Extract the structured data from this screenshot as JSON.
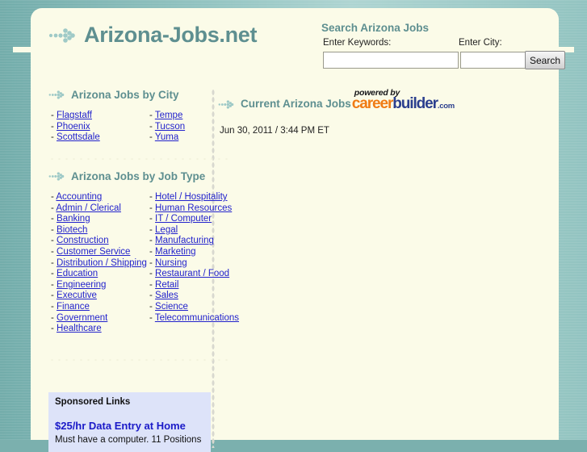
{
  "site": {
    "logo_text": "Arizona-Jobs.net",
    "logo_icon": "dotted-arrow-icon",
    "brand_color": "#5e8f90"
  },
  "search": {
    "title": "Search Arizona Jobs",
    "keywords_label": "Enter Keywords:",
    "city_label": "Enter City:",
    "keywords_value": "",
    "city_value": "",
    "keywords_placeholder": "",
    "city_placeholder": "",
    "button_label": "Search"
  },
  "cities_section": {
    "title": "Arizona Jobs by City",
    "icon": "dotted-arrow-icon",
    "column1": [
      "Flagstaff",
      "Phoenix",
      "Scottsdale"
    ],
    "column2": [
      "Tempe",
      "Tucson",
      "Yuma"
    ]
  },
  "jobtypes_section": {
    "title": "Arizona Jobs by Job Type",
    "icon": "dotted-arrow-icon",
    "column1": [
      "Accounting",
      "Admin / Clerical",
      "Banking",
      "Biotech",
      "Construction",
      "Customer Service",
      "Distribution / Shipping",
      "Education",
      "Engineering",
      "Executive",
      "Finance",
      "Government",
      "Healthcare"
    ],
    "column2": [
      "Hotel / Hospitality",
      "Human Resources",
      "IT / Computer",
      "Legal",
      "Manufacturing",
      "Marketing",
      "Nursing",
      "Restaurant / Food",
      "Retail",
      "Sales",
      "Science",
      "Telecommunications"
    ]
  },
  "current_jobs": {
    "title": "Current Arizona Jobs",
    "icon": "dotted-arrow-icon",
    "powered_by": "powered by",
    "brand_part1": "career",
    "brand_part2": "builder",
    "brand_part3": ".com",
    "brand_color1": "#f07b14",
    "brand_color2": "#2b3f8e",
    "timestamp": "Jun 30, 2011 / 3:44 PM ET"
  },
  "sponsored": {
    "heading": "Sponsored Links",
    "ad_title": "$25/hr Data Entry at Home",
    "ad_description": "Must have a computer. 11 Positions",
    "background_color": "#dde3f9"
  }
}
